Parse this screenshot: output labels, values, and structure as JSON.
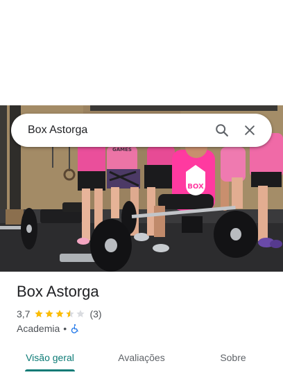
{
  "search": {
    "query": "Box Astorga",
    "search_icon": "search-icon",
    "close_icon": "close-icon"
  },
  "photo": {
    "kettlebell_text": "BOX",
    "shirt_text": "GAMES"
  },
  "place": {
    "name": "Box Astorga",
    "rating": "3,7",
    "rating_value": 3.7,
    "stars_max": 5,
    "review_count": "(3)",
    "category": "Academia",
    "separator": "•",
    "accessibility_icon": "wheelchair-icon"
  },
  "tabs": [
    {
      "label": "Visão geral",
      "active": true
    },
    {
      "label": "Avaliações",
      "active": false
    },
    {
      "label": "Sobre",
      "active": false
    }
  ],
  "colors": {
    "accent": "#0b7a75",
    "star": "#fbbc04",
    "star_empty": "#dadce0",
    "accessibility": "#1a73e8",
    "title": "#202124",
    "secondary": "#4d5156"
  }
}
